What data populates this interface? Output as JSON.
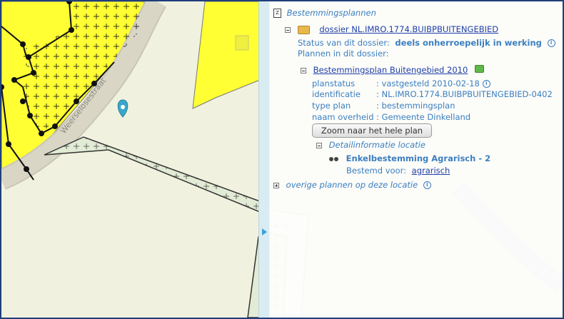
{
  "map": {
    "street_label": "Weerselosestraat"
  },
  "panel": {
    "root_label": "Bestemmingsplannen",
    "dossier": {
      "link": "dossier NL.IMRO.1774.BUIBPBUITENGEBIED",
      "status_label": "Status van dit dossier:",
      "status_value": "deels onherroepelijk in werking",
      "plans_label": "Plannen in dit dossier:"
    },
    "plan": {
      "link": "Bestemmingsplan Buitengebied 2010",
      "fields": [
        {
          "label": "planstatus",
          "value": ": vastgesteld 2010-02-18"
        },
        {
          "label": "identificatie",
          "value": ": NL.IMRO.1774.BUIBPBUITENGEBIED-0402"
        },
        {
          "label": "type plan",
          "value": ": bestemmingsplan"
        },
        {
          "label": "naam overheid",
          "value": ": Gemeente Dinkelland"
        }
      ],
      "zoom_button": "Zoom naar het hele plan"
    },
    "detail": {
      "header": "Detailinformatie locatie",
      "bestemming": "Enkelbestemming Agrarisch - 2",
      "bestemd_label": "Bestemd voor:",
      "bestemd_link": "agrarisch"
    },
    "other_plans": "overige plannen op deze locatie"
  },
  "colors": {
    "frame": "#1f3f7a",
    "yellow_zone": "#ffff33",
    "text_blue": "#3b7fc0",
    "link_blue": "#1f3fa8",
    "marker": "#3aa7c9"
  }
}
